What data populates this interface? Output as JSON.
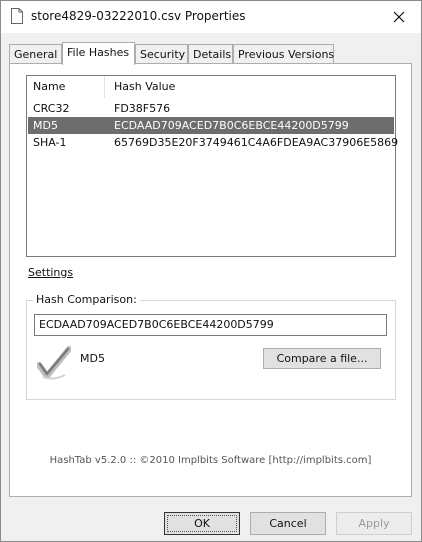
{
  "window": {
    "title": "store4829-03222010.csv Properties"
  },
  "tabs": [
    {
      "label": "General"
    },
    {
      "label": "File Hashes"
    },
    {
      "label": "Security"
    },
    {
      "label": "Details"
    },
    {
      "label": "Previous Versions"
    }
  ],
  "hash_list": {
    "columns": [
      "Name",
      "Hash Value"
    ],
    "rows": [
      {
        "name": "CRC32",
        "value": "FD38F576"
      },
      {
        "name": "MD5",
        "value": "ECDAAD709ACED7B0C6EBCE44200D5799"
      },
      {
        "name": "SHA-1",
        "value": "65769D35E20F3749461C4A6FDEA9AC37906E5869"
      }
    ],
    "selected_row": "MD5"
  },
  "settings_link": "Settings",
  "comparison": {
    "label": "Hash Comparison:",
    "input_value": "ECDAAD709ACED7B0C6EBCE44200D5799",
    "match_algorithm": "MD5",
    "compare_button": "Compare a file..."
  },
  "footer": "HashTab v5.2.0 :: ©2010 Implbits Software [http://implbits.com]",
  "buttons": {
    "ok": "OK",
    "cancel": "Cancel",
    "apply": "Apply"
  }
}
